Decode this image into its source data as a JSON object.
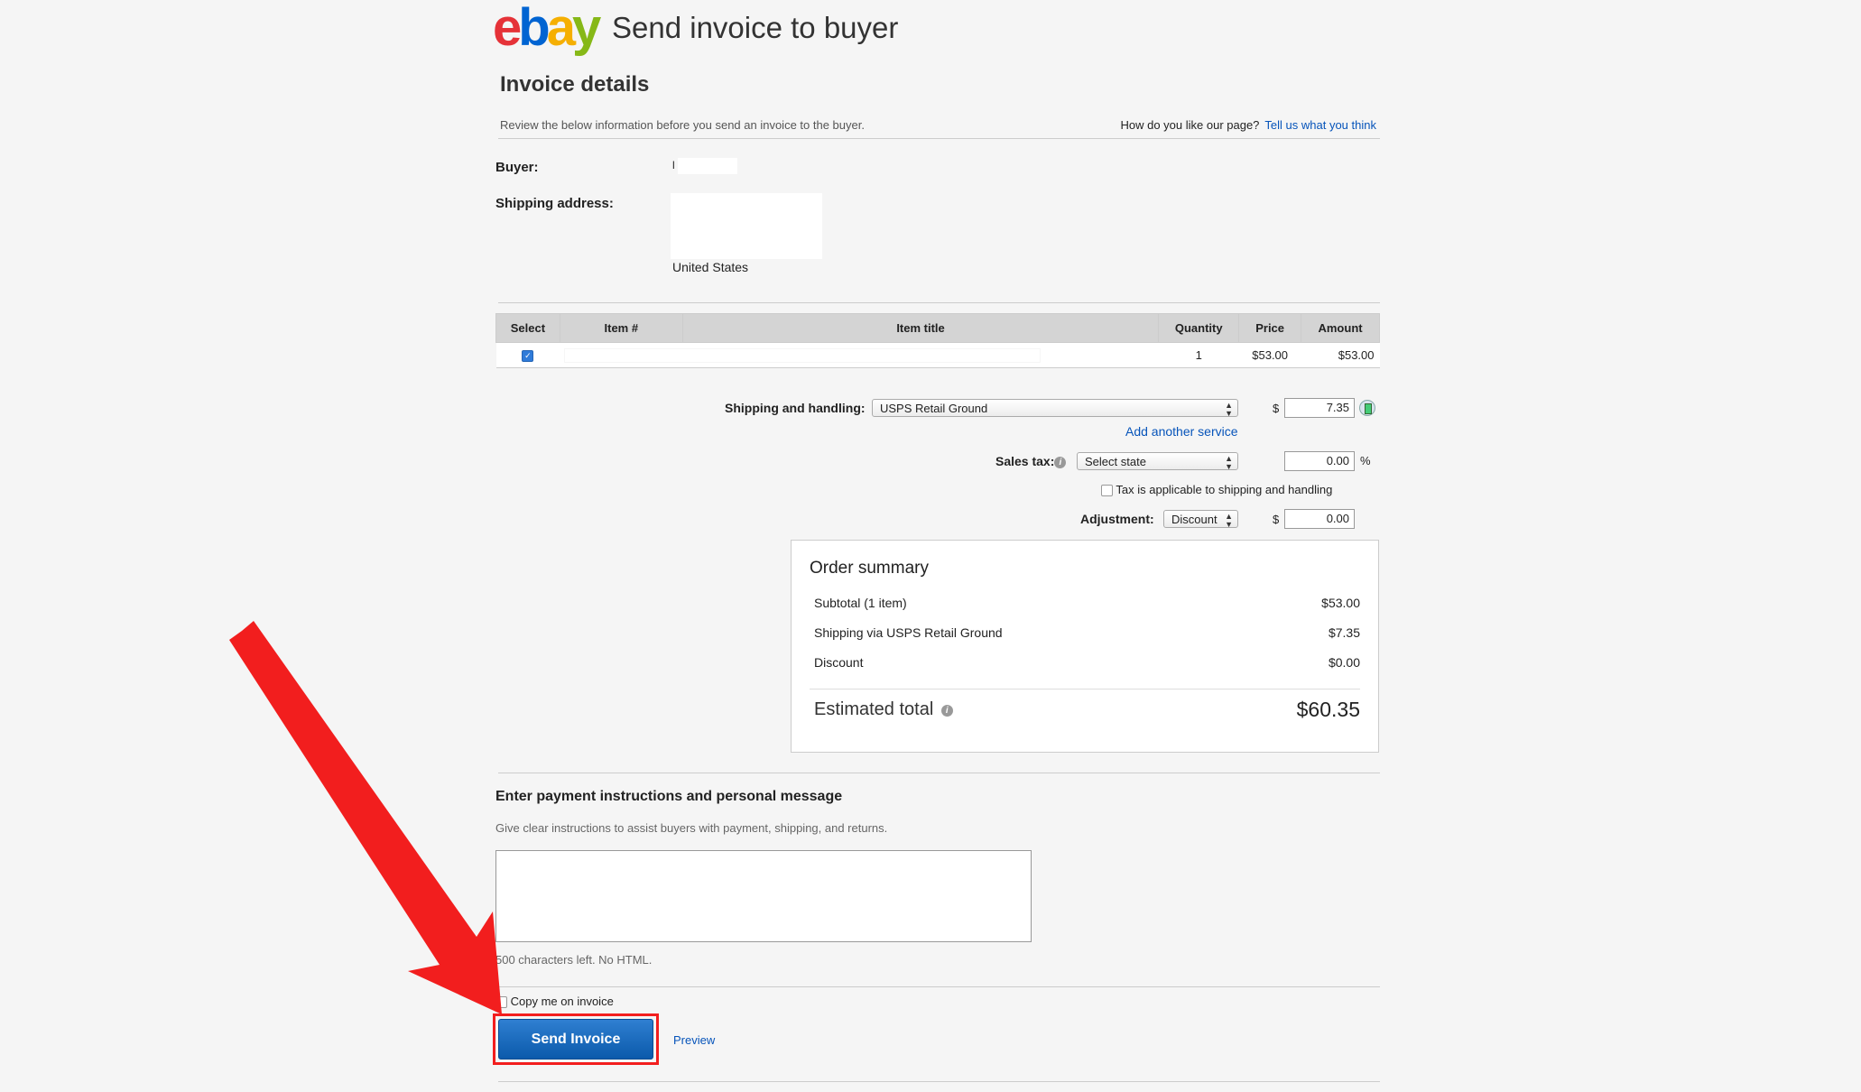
{
  "header": {
    "logo_letters": [
      {
        "ch": "e",
        "color": "#e53238"
      },
      {
        "ch": "b",
        "color": "#0064d2"
      },
      {
        "ch": "a",
        "color": "#f5af02"
      },
      {
        "ch": "y",
        "color": "#86b817"
      }
    ],
    "title": "Send invoice to buyer"
  },
  "invoice": {
    "heading": "Invoice details",
    "review_note": "Review the below information before you send an invoice to the buyer.",
    "feedback_question": "How do you like our page?",
    "feedback_link": "Tell us what you think",
    "buyer_label": "Buyer:",
    "buyer_initial": "l",
    "shipping_label": "Shipping address:",
    "country": "United States"
  },
  "items_table": {
    "headers": [
      "Select",
      "Item #",
      "Item title",
      "Quantity",
      "Price",
      "Amount"
    ],
    "rows": [
      {
        "selected": true,
        "item_no": "",
        "title": "",
        "quantity": "1",
        "price": "$53.00",
        "amount": "$53.00"
      }
    ]
  },
  "charges": {
    "shipping_label": "Shipping and handling:",
    "shipping_service": "USPS Retail Ground",
    "currency": "$",
    "shipping_cost": "7.35",
    "add_service": "Add another service",
    "tax_label": "Sales tax:",
    "tax_state": "Select state",
    "tax_rate": "0.00",
    "percent": "%",
    "tax_shipping_note": "Tax is applicable to shipping and handling",
    "adjustment_label": "Adjustment:",
    "adjustment_type": "Discount",
    "adjustment_value": "0.00"
  },
  "summary": {
    "title": "Order summary",
    "rows": [
      {
        "label": "Subtotal (1 item)",
        "value": "$53.00"
      },
      {
        "label": "Shipping via USPS Retail Ground",
        "value": "$7.35"
      },
      {
        "label": "Discount",
        "value": "$0.00"
      }
    ],
    "total_label": "Estimated total",
    "total_value": "$60.35"
  },
  "message": {
    "heading": "Enter payment instructions and personal message",
    "help": "Give clear instructions to assist buyers with payment, shipping, and returns.",
    "chars_left": "500 characters left. No HTML."
  },
  "footer": {
    "copy_me": "Copy me on invoice",
    "send_button": "Send Invoice",
    "preview": "Preview"
  },
  "annotation": {
    "arrow_color": "#f21e1e"
  }
}
